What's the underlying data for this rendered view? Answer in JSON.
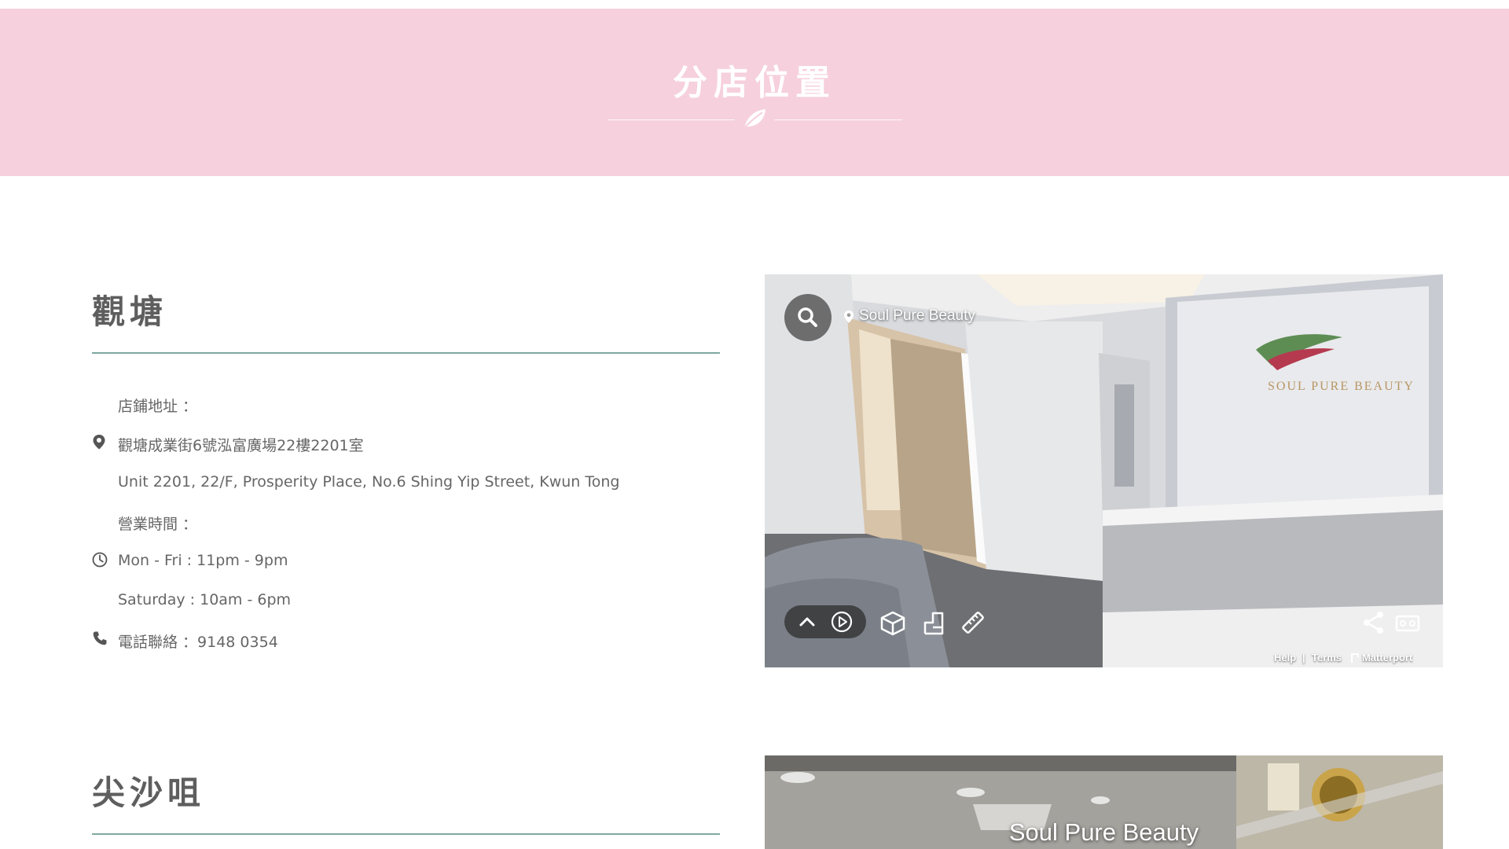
{
  "banner": {
    "title": "分店位置",
    "background": "#f6d0dd",
    "icon": "leaf-icon"
  },
  "branches": [
    {
      "name": "觀塘",
      "address_label": "店鋪地址 ：",
      "address_zh": "觀塘成業街6號泓富廣場22樓2201室",
      "address_en": "Unit 2201, 22/F, Prosperity Place, No.6 Shing Yip Street, Kwun Tong",
      "hours_label": "營業時間 ：",
      "hours_weekday": "Mon - Fri : 11pm - 9pm",
      "hours_saturday": "Saturday : 10am - 6pm",
      "phone": "電話聯絡 ：9148 0354",
      "tour": {
        "place_name": "Soul Pure Beauty",
        "logo_text": "SOUL   PURE   BEAUTY",
        "footer": {
          "help": "Help",
          "separator": "|",
          "terms": "Terms",
          "brand": "Matterport"
        },
        "icons": [
          "search-icon",
          "location-pin-icon",
          "chevron-up-icon",
          "play-icon",
          "dollhouse-icon",
          "floorplan-icon",
          "measure-icon",
          "share-icon",
          "vr-icon"
        ]
      }
    },
    {
      "name": "尖沙咀",
      "tour": {
        "caption": "Soul Pure Beauty"
      }
    }
  ],
  "colors": {
    "accent_rule": "#7fa9a0",
    "text": "#666666",
    "heading": "#5e5e5e"
  }
}
